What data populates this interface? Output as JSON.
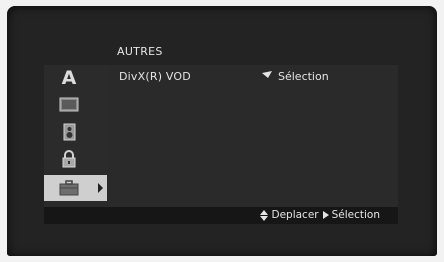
{
  "menu": {
    "title": "AUTRES",
    "tabs": [
      {
        "name": "language",
        "icon": "letter-a-icon",
        "glyph": "A"
      },
      {
        "name": "display",
        "icon": "tv-screen-icon"
      },
      {
        "name": "audio",
        "icon": "speaker-icon"
      },
      {
        "name": "lock",
        "icon": "padlock-icon"
      },
      {
        "name": "others",
        "icon": "toolbox-icon",
        "active": true
      }
    ],
    "rows": [
      {
        "label": "DivX(R) VOD",
        "value": "Sélection"
      }
    ]
  },
  "footer": {
    "move_label": "Deplacer",
    "select_label": "Sélection"
  },
  "colors": {
    "screen": "#232323",
    "panel": "#2a2a2a",
    "active_tab": "#cfcfcf",
    "text": "#e4e4e4"
  }
}
